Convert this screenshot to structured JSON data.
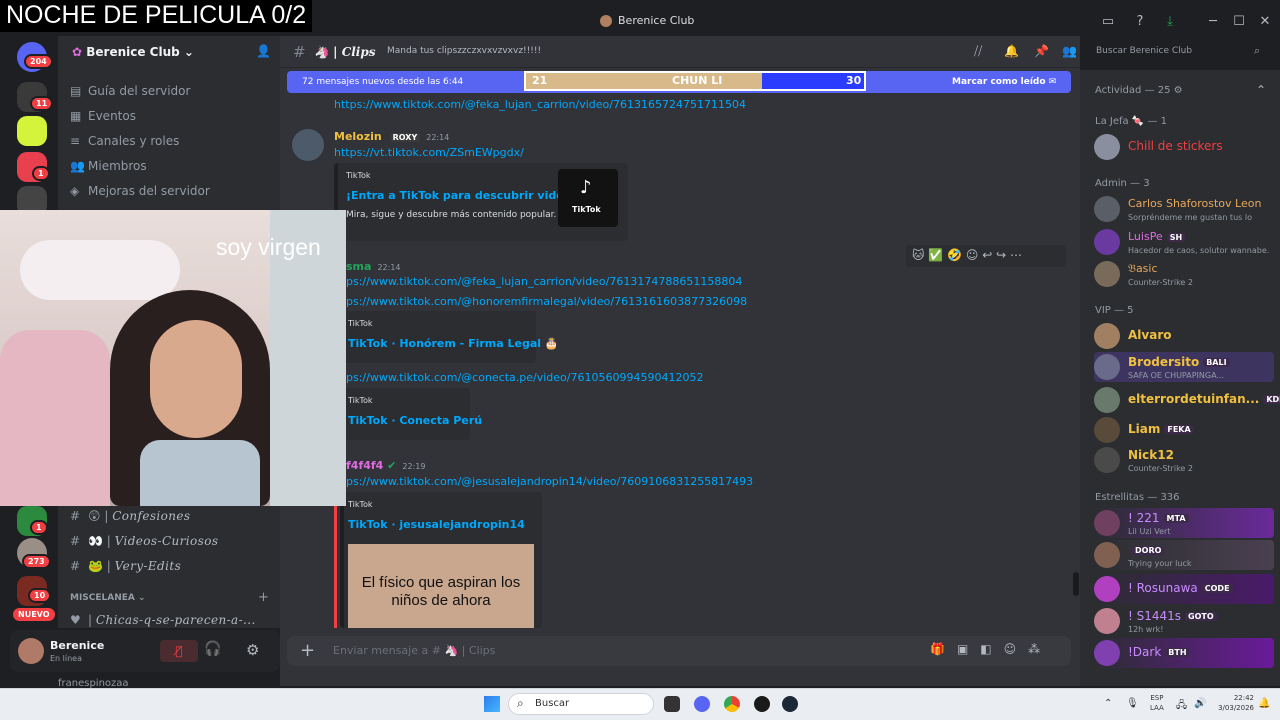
{
  "stream": {
    "title": "NOCHE DE PELICULA 0/2",
    "overlay_text": "soy virgen"
  },
  "window": {
    "title": "Berenice Club"
  },
  "rail": {
    "badges": [
      "204",
      "11",
      "1",
      "1",
      "273",
      "10"
    ],
    "new_label": "NUEVO"
  },
  "server": {
    "name": "Berenice Club",
    "menu": [
      "Guía del servidor",
      "Eventos",
      "Canales y roles",
      "Miembros",
      "Mejoras del servidor"
    ],
    "channels": [
      {
        "emoji": "😲",
        "name": "Confesiones"
      },
      {
        "emoji": "👀",
        "name": "Videos-Curiosos"
      },
      {
        "emoji": "🐸",
        "name": "Very-Edits"
      }
    ],
    "category": "MISCELANEA",
    "category_channel": "Chicas-q-se-parecen-a-...",
    "hidden_user": "franespinozaa"
  },
  "user": {
    "name": "Berenice",
    "status": "En línea"
  },
  "channel": {
    "name": "Clips",
    "topic": "Manda tus clipszzczxvxvzvxvz!!!!!",
    "search_placeholder": "Buscar Berenice Club"
  },
  "new_messages": {
    "text": "72 mensajes nuevos desde las 6:44",
    "score_left": "21",
    "score_name": "CHUN LI",
    "score_right": "30",
    "mark_read": "Marcar como leído"
  },
  "messages": [
    {
      "link": "https://www.tiktok.com/@feka_lujan_carrion/video/7613165724751711504"
    },
    {
      "author": "Melozin",
      "tag": "ROXY",
      "time": "22:14",
      "link": "https://vt.tiktok.com/ZSmEWpgdx/",
      "embed": {
        "provider": "TikTok",
        "title": "¡Entra a TikTok para descubrir videos!",
        "desc": "Mira, sigue y descubre más contenido popular.",
        "thumb_label": "TikTok"
      }
    },
    {
      "author": "sma",
      "time": "22:14",
      "links": [
        "ps://www.tiktok.com/@feka_lujan_carrion/video/7613174788651158804",
        "ps://www.tiktok.com/@honoremfirmalegal/video/7613161603877326098"
      ],
      "embed1": {
        "provider": "TikTok",
        "title": "TikTok · Honórem - Firma Legal 🎂"
      },
      "link3": "ps://www.tiktok.com/@conecta.pe/video/7610560994590412052",
      "embed2": {
        "provider": "TikTok",
        "title": "TikTok · Conecta Perú"
      }
    },
    {
      "author": "f4f4f4",
      "time": "22:19",
      "link": "ps://www.tiktok.com/@jesusalejandropin14/video/7609106831255817493",
      "embed": {
        "provider": "TikTok",
        "title": "TikTok · jesusalejandropin14",
        "image_caption": "El físico que aspiran los niños de ahora"
      }
    }
  ],
  "composer": {
    "placeholder": "Enviar mensaje a # 🦄 | Clips"
  },
  "members": {
    "activity": "Actividad — 25",
    "groups": [
      {
        "label": "La Jefa 🍬 — 1",
        "items": [
          {
            "name": "Chill de stickers",
            "sub": "",
            "color": "#f23f43"
          }
        ]
      },
      {
        "label": "Admin — 3",
        "items": [
          {
            "name": "Carlos Shaforostov Leon",
            "sub": "Sorpréndeme me gustan tus lo",
            "color": "#e8a85a"
          },
          {
            "name": "LuisPe",
            "tag": "SH",
            "sub": "Hacedor de caos, solutor wannabe.",
            "color": "#e06be0"
          },
          {
            "name": "𝔅asic",
            "sub": "Counter-Strike 2",
            "color": "#e8a85a"
          }
        ]
      },
      {
        "label": "VIP — 5",
        "items": [
          {
            "name": "Alvaro",
            "sub": "",
            "color": "#f0c040"
          },
          {
            "name": "Brodersito",
            "tag": "BALI",
            "sub": "SAFA OE CHUPAPINGA...",
            "color": "#f0c040"
          },
          {
            "name": "elterrordetuinfan...",
            "tag": "KDR",
            "sub": "",
            "color": "#f0c040"
          },
          {
            "name": "Liam",
            "tag": "FEKA",
            "sub": "",
            "color": "#f0c040"
          },
          {
            "name": "Nick12",
            "sub": "Counter-Strike 2",
            "color": "#f0c040"
          }
        ]
      },
      {
        "label": "Estrellitas — 336",
        "items": [
          {
            "name": "! 221",
            "tag": "MTA",
            "sub": "Lil Uzi Vert",
            "color": "#c98bff"
          },
          {
            "name": "",
            "tag": "DORO",
            "sub": "Trying your luck",
            "color": "#f23f43"
          },
          {
            "name": "! Rosunawa",
            "tag": "CODE",
            "sub": "",
            "color": "#c98bff"
          },
          {
            "name": "! S1441s",
            "tag": "GOTO",
            "sub": "12h wrk!",
            "color": "#c98bff"
          },
          {
            "name": "!Dark",
            "tag": "BTH",
            "sub": "",
            "color": "#c98bff"
          }
        ]
      }
    ]
  },
  "taskbar": {
    "search": "Buscar",
    "lang1": "ESP",
    "lang2": "LAA",
    "time": "22:42",
    "date": "3/03/2026"
  },
  "colors": {
    "accent": "#5865f2",
    "link": "#00a8fc",
    "mention": "#f23f43"
  }
}
